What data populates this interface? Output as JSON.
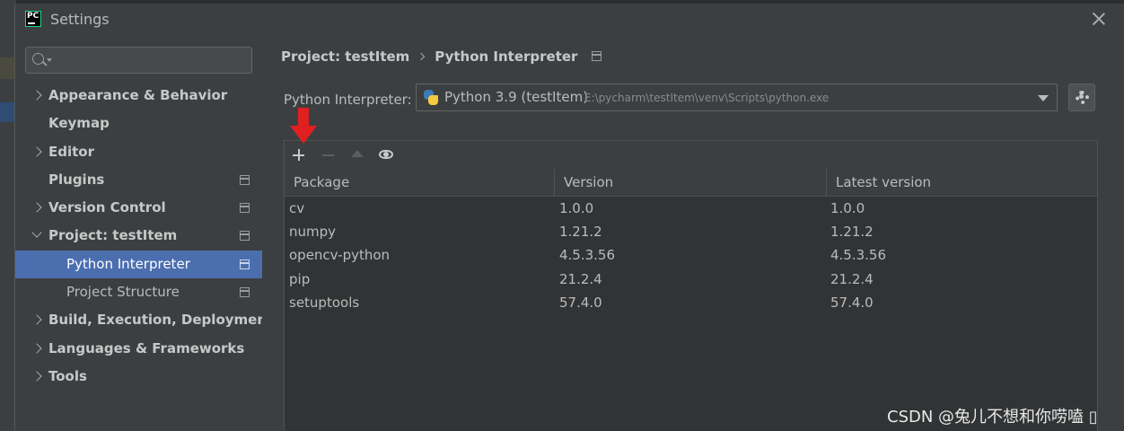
{
  "window": {
    "title": "Settings"
  },
  "search": {
    "placeholder": "",
    "value": ""
  },
  "sidebar": {
    "items": [
      {
        "label": "Appearance & Behavior"
      },
      {
        "label": "Keymap"
      },
      {
        "label": "Editor"
      },
      {
        "label": "Plugins"
      },
      {
        "label": "Version Control"
      },
      {
        "label": "Project: testItem"
      },
      {
        "label": "Python Interpreter"
      },
      {
        "label": "Project Structure"
      },
      {
        "label": "Build, Execution, Deployment"
      },
      {
        "label": "Languages & Frameworks"
      },
      {
        "label": "Tools"
      }
    ]
  },
  "breadcrumb": {
    "project": "Project: testItem",
    "page": "Python Interpreter"
  },
  "interpreter": {
    "label": "Python Interpreter:",
    "name": "Python 3.9 (testItem)",
    "path": "E:\\pycharm\\testItem\\venv\\Scripts\\python.exe"
  },
  "packages": {
    "columns": [
      "Package",
      "Version",
      "Latest version"
    ],
    "rows": [
      [
        "cv",
        "1.0.0",
        "1.0.0"
      ],
      [
        "numpy",
        "1.21.2",
        "1.21.2"
      ],
      [
        "opencv-python",
        "4.5.3.56",
        "4.5.3.56"
      ],
      [
        "pip",
        "21.2.4",
        "21.2.4"
      ],
      [
        "setuptools",
        "57.4.0",
        "57.4.0"
      ]
    ]
  },
  "watermark": "CSDN @兔儿不想和你唠嗑 ▯",
  "colors": {
    "selection": "#4b6eaf",
    "annotation_arrow": "#e02020",
    "background": "#3c3f41"
  },
  "icons": [
    "pycharm-logo",
    "close-icon",
    "search-icon",
    "chevron-right-icon",
    "chevron-down-icon",
    "page-icon",
    "python-icon",
    "gear-icon",
    "plus-icon",
    "minus-icon",
    "upgrade-icon",
    "eye-icon"
  ]
}
